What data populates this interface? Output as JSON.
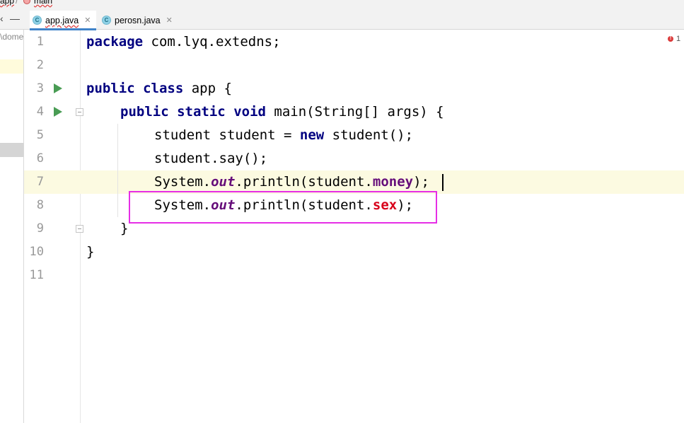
{
  "breadcrumb": {
    "items": [
      "app",
      "main"
    ]
  },
  "tabs": [
    {
      "label": "app.java",
      "icon": "C",
      "active": true
    },
    {
      "label": "perosn.java",
      "icon": "C",
      "active": false
    }
  ],
  "left_panel": {
    "path_fragment": "\\dome",
    "collapse_symbol": "—"
  },
  "editor": {
    "error_count": "1",
    "lines": [
      {
        "num": "1"
      },
      {
        "num": "2"
      },
      {
        "num": "3"
      },
      {
        "num": "4"
      },
      {
        "num": "5"
      },
      {
        "num": "6"
      },
      {
        "num": "7"
      },
      {
        "num": "8"
      },
      {
        "num": "9"
      },
      {
        "num": "10"
      },
      {
        "num": "11"
      }
    ],
    "tokens": {
      "l1_kw": "package",
      "l1_rest": " com.lyq.extedns;",
      "l3_kw1": "public",
      "l3_kw2": "class",
      "l3_rest": " app {",
      "l4_kw1": "public",
      "l4_kw2": "static",
      "l4_kw3": "void",
      "l4_rest": " main(String[] args) {",
      "l5_a": "student student = ",
      "l5_kw": "new",
      "l5_b": " student();",
      "l6": "student.say();",
      "l7_a": "System.",
      "l7_out": "out",
      "l7_b": ".println(student.",
      "l7_field": "money",
      "l7_c": ");",
      "l8_a": "System.",
      "l8_out": "out",
      "l8_b": ".println(student.",
      "l8_field": "sex",
      "l8_c": ");",
      "l9": "}",
      "l10": "}"
    }
  },
  "colors": {
    "keyword": "#000080",
    "field": "#660e7a",
    "error_field": "#d8001a",
    "highlight_box": "#e62ee6",
    "run_icon": "#499c54",
    "current_line": "#fcfae1"
  }
}
